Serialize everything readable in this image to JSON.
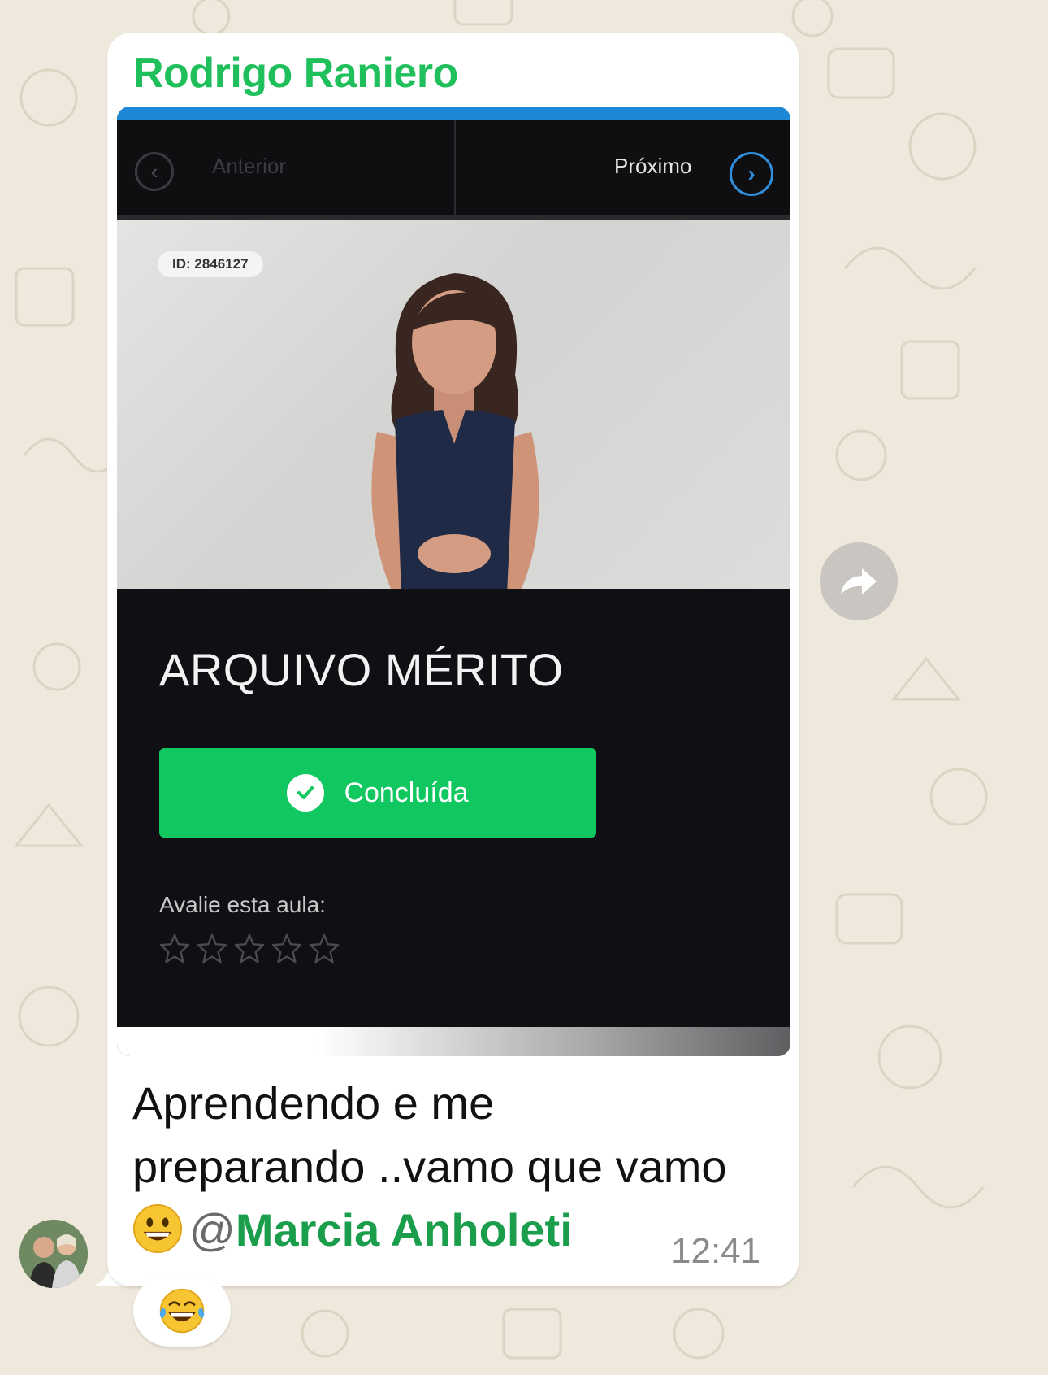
{
  "message": {
    "sender_name": "Rodrigo Raniero",
    "caption_line1": "Aprendendo e me",
    "caption_line2": "preparando ..vamo que vamo",
    "mention_at": "@",
    "mention_name": "Marcia Anholeti",
    "time": "12:41",
    "reaction": "laughing-tears-emoji"
  },
  "screenshot": {
    "nav_prev_label": "Anterior",
    "nav_next_label": "Próximo",
    "video_id": "ID: 2846127",
    "lesson_title": "ARQUIVO MÉRITO",
    "complete_button_label": "Concluída",
    "rating_label": "Avalie esta aula:",
    "rating_stars_total": 5,
    "rating_stars_filled": 0
  },
  "colors": {
    "sender": "#1fbf5b",
    "mention": "#1b9e4b",
    "complete_button": "#11c760",
    "accent_blue": "#1d88d8",
    "chat_background": "#efe8dc"
  },
  "icons": [
    "forward-icon",
    "chevron-left-icon",
    "chevron-right-icon",
    "check-icon",
    "star-icon",
    "grinning-emoji",
    "laughing-tears-emoji"
  ]
}
